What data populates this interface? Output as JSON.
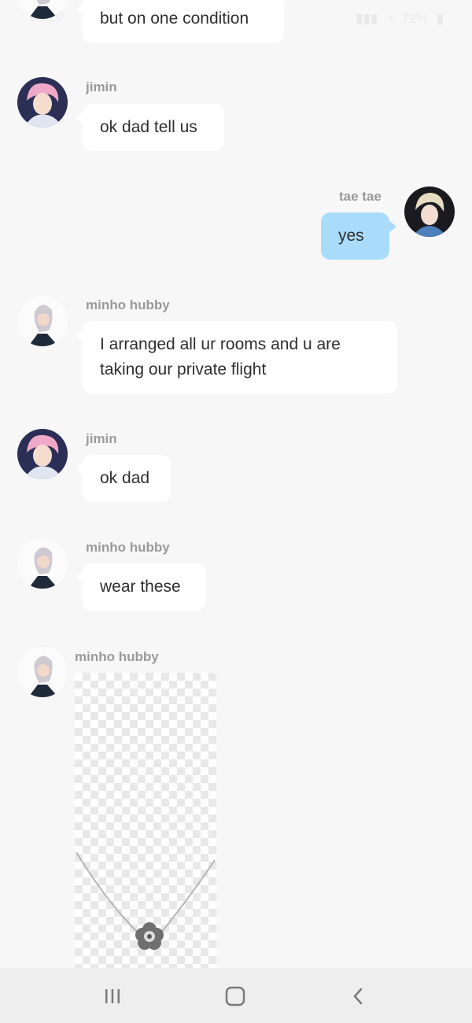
{
  "status_bar": {
    "time": "08:20",
    "battery": "72%"
  },
  "messages": [
    {
      "sender": "minho hubby",
      "text": "but on one condition",
      "avatar": "minho-avatar"
    },
    {
      "sender": "jimin",
      "text": "ok dad tell us",
      "avatar": "jimin-avatar"
    },
    {
      "sender": "tae tae",
      "text": "yes",
      "avatar": "tae-avatar",
      "mine": true
    },
    {
      "sender": "minho hubby",
      "text": "I arranged all ur rooms and u are taking our private flight",
      "avatar": "minho-avatar"
    },
    {
      "sender": "jimin",
      "text": "ok dad",
      "avatar": "jimin-avatar"
    },
    {
      "sender": "minho hubby",
      "text": "wear these",
      "avatar": "minho-avatar"
    },
    {
      "sender": "minho hubby",
      "image": "necklace-image",
      "avatar": "minho-avatar"
    }
  ],
  "nav_bar": {
    "recents_icon": "recents-icon",
    "home_icon": "home-icon",
    "back_icon": "back-icon"
  },
  "colors": {
    "background": "#f7f7f7",
    "bubble": "#ffffff",
    "my_bubble": "#a9dcfb",
    "name": "#9a9a9a"
  }
}
